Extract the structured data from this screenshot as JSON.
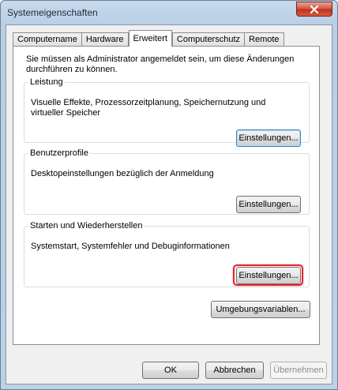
{
  "window": {
    "title": "Systemeigenschaften"
  },
  "tabs": [
    {
      "label": "Computername"
    },
    {
      "label": "Hardware"
    },
    {
      "label": "Erweitert"
    },
    {
      "label": "Computerschutz"
    },
    {
      "label": "Remote"
    }
  ],
  "intro": "Sie müssen als Administrator angemeldet sein, um diese Änderungen durchführen zu können.",
  "groups": {
    "performance": {
      "title": "Leistung",
      "description": "Visuelle Effekte, Prozessorzeitplanung, Speichernutzung und virtueller Speicher",
      "button": "Einstellungen..."
    },
    "profiles": {
      "title": "Benutzerprofile",
      "description": "Desktopeinstellungen bezüglich der Anmeldung",
      "button": "Einstellungen..."
    },
    "startup": {
      "title": "Starten und Wiederherstellen",
      "description": "Systemstart, Systemfehler und Debuginformationen",
      "button": "Einstellungen..."
    }
  },
  "env_button": "Umgebungsvariablen...",
  "footer": {
    "ok": "OK",
    "cancel": "Abbrechen",
    "apply": "Übernehmen"
  },
  "colors": {
    "highlight": "#e8222b",
    "focus_border": "#3c7fb1"
  }
}
